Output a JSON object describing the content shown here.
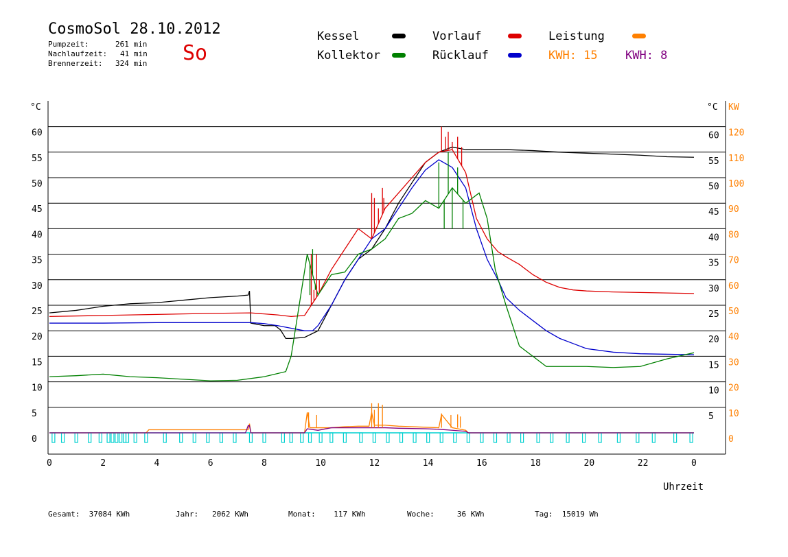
{
  "header": {
    "title": "CosmoSol 28.10.2012",
    "day": "So",
    "stats": [
      {
        "label": "Pumpzeit:",
        "value": "261 min"
      },
      {
        "label": "Nachlaufzeit:",
        "value": "41 min"
      },
      {
        "label": "Brennerzeit:",
        "value": "324 min"
      }
    ]
  },
  "legend": {
    "kessel": "Kessel",
    "kollektor": "Kollektor",
    "vorlauf": "Vorlauf",
    "ruecklauf": "Rücklauf",
    "leistung": "Leistung",
    "kwh_orange": "KWH: 15",
    "kwh_purple": "KWH: 8"
  },
  "colors": {
    "kessel": "#000000",
    "kollektor": "#008000",
    "vorlauf": "#dd0000",
    "ruecklauf": "#0000cc",
    "leistung": "#ff8000",
    "kwh_purple": "#800080",
    "pump": "#00d0d0"
  },
  "footer": {
    "gesamt": "Gesamt:  37084 KWh",
    "jahr": "Jahr:   2062 KWh",
    "monat": "Monat:    117 KWh",
    "woche": "Woche:     36 KWh",
    "tag": "Tag:  15019 Wh"
  },
  "chart_data": {
    "type": "line",
    "xlabel": "Uhrzeit",
    "y_unit_left": "°C",
    "y_unit_right": "°C",
    "y2_unit": "KW",
    "x_ticks": [
      "0",
      "2",
      "4",
      "6",
      "8",
      "10",
      "12",
      "14",
      "16",
      "18",
      "20",
      "22",
      "0"
    ],
    "xlim": [
      0,
      24
    ],
    "ylim": [
      -5,
      65
    ],
    "y_ticks": [
      0,
      5,
      10,
      15,
      20,
      25,
      30,
      35,
      40,
      45,
      50,
      55,
      60
    ],
    "y2_ticks": [
      0,
      10,
      20,
      30,
      40,
      50,
      60,
      70,
      80,
      90,
      100,
      110,
      120
    ],
    "grid": true,
    "series": [
      {
        "name": "Kessel",
        "color": "#000000",
        "x": [
          0,
          1,
          2,
          3,
          4,
          5,
          6,
          7,
          7.4,
          7.45,
          7.5,
          8,
          8.4,
          8.6,
          8.8,
          9,
          9.5,
          10,
          10.5,
          11,
          11.5,
          12,
          12.5,
          13,
          13.5,
          14,
          14.5,
          15,
          15.5,
          16,
          17,
          18,
          19,
          20,
          21,
          22,
          23,
          24
        ],
        "y": [
          23.5,
          24,
          24.8,
          25.3,
          25.5,
          26,
          26.5,
          26.8,
          27,
          27.8,
          21.5,
          21,
          21,
          20.2,
          18.5,
          18.5,
          18.7,
          20,
          25,
          30,
          34,
          36,
          40,
          45,
          49,
          53,
          55,
          56,
          55.5,
          55.5,
          55.5,
          55.3,
          55,
          54.8,
          54.6,
          54.4,
          54.1,
          54
        ]
      },
      {
        "name": "Vorlauf",
        "color": "#dd0000",
        "x": [
          0,
          2,
          4,
          6,
          7.5,
          8,
          8.5,
          9,
          9.5,
          10,
          10.5,
          11,
          11.5,
          12,
          12.5,
          13,
          13.5,
          14,
          14.5,
          15,
          15.5,
          15.9,
          16.3,
          16.7,
          17,
          17.5,
          18,
          18.5,
          19,
          19.5,
          20,
          21,
          22,
          23,
          24
        ],
        "y": [
          22.8,
          23,
          23.2,
          23.4,
          23.5,
          23.3,
          23.1,
          22.8,
          23,
          27,
          32,
          36,
          40,
          38,
          44,
          47,
          50,
          53,
          55,
          55.5,
          51,
          42,
          38,
          35.5,
          34.5,
          33,
          31,
          29.5,
          28.5,
          28,
          27.8,
          27.6,
          27.5,
          27.4,
          27.3
        ]
      },
      {
        "name": "Rücklauf",
        "color": "#0000cc",
        "x": [
          0,
          2,
          4,
          6,
          7.5,
          8,
          8.5,
          9,
          9.5,
          9.8,
          10,
          10.5,
          11,
          11.5,
          12,
          12.5,
          13,
          13.5,
          14,
          14.5,
          15,
          15.5,
          15.9,
          16.3,
          16.7,
          17,
          17.5,
          18,
          18.5,
          19,
          19.5,
          20,
          21,
          22,
          23,
          24
        ],
        "y": [
          21.5,
          21.5,
          21.6,
          21.6,
          21.6,
          21.4,
          21,
          20.5,
          20,
          20,
          21,
          25,
          30,
          34,
          38,
          40,
          44,
          48,
          51.5,
          53.5,
          52,
          48,
          40,
          34,
          30,
          26.5,
          24,
          22,
          20,
          18.5,
          17.5,
          16.5,
          15.8,
          15.5,
          15.4,
          15.3
        ]
      },
      {
        "name": "Kollektor",
        "color": "#008000",
        "x": [
          0,
          1,
          2,
          3,
          4,
          5,
          6,
          7,
          8,
          8.8,
          9,
          9.3,
          9.6,
          10,
          10.5,
          11,
          11.5,
          12,
          12.5,
          13,
          13.5,
          14,
          14.5,
          15,
          15.5,
          16,
          16.3,
          16.6,
          17,
          17.5,
          18,
          18.5,
          19,
          20,
          21,
          22,
          23,
          24
        ],
        "y": [
          11,
          11.2,
          11.5,
          11,
          10.8,
          10.5,
          10.2,
          10.3,
          11,
          12,
          15,
          25,
          35,
          27,
          31,
          31.5,
          35,
          36,
          38,
          42,
          43,
          45.5,
          44,
          48,
          45,
          47,
          42,
          32,
          25,
          17,
          15,
          13,
          13,
          13,
          12.8,
          13,
          14.5,
          15.7
        ]
      }
    ],
    "power_series": [
      {
        "name": "Leistung",
        "color": "#ff8000",
        "x": [
          0,
          3.6,
          3.7,
          7.4,
          7.45,
          7.5,
          9.5,
          9.6,
          9.7,
          10,
          10.5,
          11,
          11.5,
          11.9,
          12,
          12.1,
          12.5,
          13,
          13.5,
          14,
          14.5,
          14.6,
          15,
          15.5,
          15.6,
          16,
          24
        ],
        "y": [
          0,
          0,
          0.6,
          0.6,
          1.8,
          0,
          0,
          4,
          1,
          1,
          1,
          1.2,
          1.3,
          1.3,
          4,
          1.5,
          1.5,
          1.3,
          1.2,
          1.1,
          1,
          3.6,
          1,
          0.5,
          0,
          0,
          0
        ]
      },
      {
        "name": "KWH: 8",
        "color": "#800080",
        "x": [
          0,
          7.3,
          7.4,
          7.45,
          7.5,
          9.5,
          9.6,
          10,
          10.5,
          11,
          12,
          12.5,
          13,
          14,
          14.5,
          15,
          15.5,
          15.6,
          16,
          24
        ],
        "y": [
          0,
          0,
          1.4,
          1.4,
          0,
          0,
          0.8,
          0.5,
          1,
          1,
          1,
          1,
          0.9,
          0.8,
          0.7,
          0.5,
          0.3,
          0,
          0,
          0
        ]
      }
    ],
    "spikes": [
      {
        "series": "Vorlauf",
        "x": [
          9.75,
          9.85,
          9.95,
          10.05,
          12.0,
          12.1,
          12.25,
          12.4,
          12.45,
          14.6,
          14.75,
          14.85,
          15.0,
          15.2,
          15.35
        ],
        "y": [
          35,
          28,
          35,
          30,
          47,
          46,
          44,
          48,
          46,
          60,
          58,
          59,
          57,
          58,
          56
        ]
      },
      {
        "series": "Kollektor",
        "x": [
          9.6,
          9.7,
          9.8,
          9.9,
          14.5,
          14.7,
          14.85,
          15.0,
          15.2,
          15.4
        ],
        "y": [
          35,
          27,
          36,
          28,
          53,
          40,
          55,
          40,
          52,
          40
        ]
      },
      {
        "series": "Leistung",
        "x": [
          9.65,
          9.95,
          12.0,
          12.1,
          12.25,
          12.4,
          14.6,
          14.95,
          15.2,
          15.3
        ],
        "y": [
          4,
          3.5,
          5.8,
          4.5,
          5.8,
          5.5,
          3.8,
          3.5,
          3.6,
          3.2
        ]
      }
    ],
    "pump_ticks": [
      0.15,
      0.5,
      1.0,
      1.5,
      1.9,
      2.2,
      2.35,
      2.5,
      2.65,
      2.8,
      2.9,
      3.2,
      3.6,
      4.3,
      4.9,
      5.4,
      5.9,
      6.4,
      6.9,
      7.5,
      8.0,
      8.7,
      9.0,
      9.4,
      9.7,
      10.1,
      10.5,
      11.0,
      11.6,
      12.1,
      12.6,
      13.1,
      13.6,
      14.1,
      14.6,
      15.1,
      15.6,
      16.1,
      16.6,
      17.1,
      17.6,
      18.2,
      18.7,
      19.3,
      19.9,
      20.5,
      21.2,
      21.9,
      22.5,
      23.3,
      23.9
    ]
  }
}
